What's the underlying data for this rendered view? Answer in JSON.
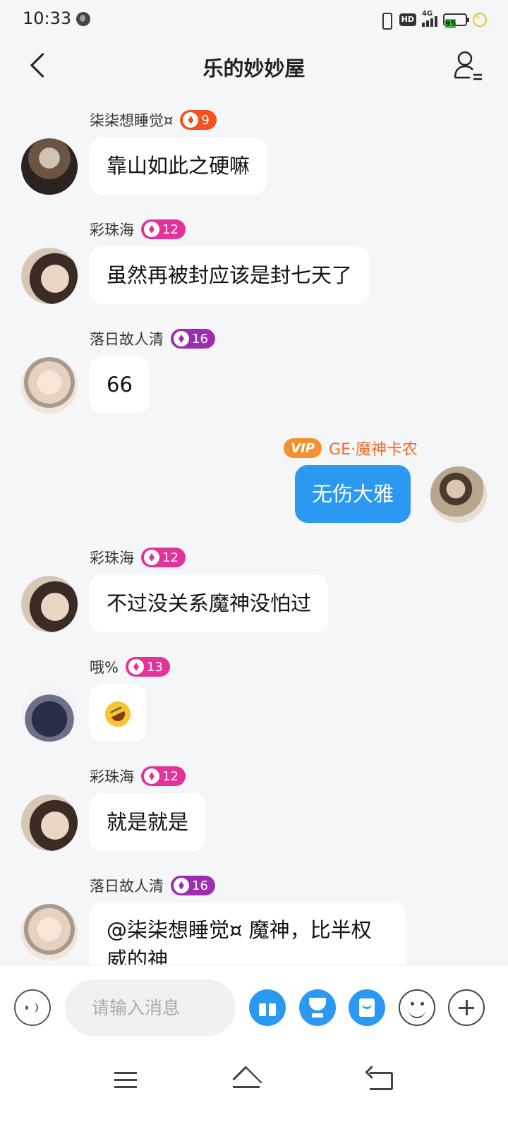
{
  "status_bar": {
    "time": "10:33",
    "network": "4G",
    "hd_label": "HD",
    "battery": "95"
  },
  "header": {
    "title": "乐的妙妙屋"
  },
  "messages": [
    {
      "sender": "柒柒想睡觉¤",
      "level": "9",
      "badge_color": "#f4511e",
      "text": "靠山如此之硬嘛"
    },
    {
      "sender": "彩珠海",
      "level": "12",
      "badge_color": "#e3329a",
      "text": "虽然再被封应该是封七天了"
    },
    {
      "sender": "落日故人清",
      "level": "16",
      "badge_color": "#9b2fb0",
      "text": "66"
    },
    {
      "sender": "GE·魔神卡农",
      "vip": "VIP",
      "text": "无伤大雅"
    },
    {
      "sender": "彩珠海",
      "level": "12",
      "badge_color": "#e3329a",
      "text": "不过没关系魔神没怕过"
    },
    {
      "sender": "哦%",
      "level": "13",
      "badge_color": "#e3329a",
      "text": "rolling-on-floor-laughing-emoji"
    },
    {
      "sender": "彩珠海",
      "level": "12",
      "badge_color": "#e3329a",
      "text": "就是就是"
    },
    {
      "sender": "落日故人清",
      "level": "16",
      "badge_color": "#9b2fb0",
      "text": "@柒柒想睡觉¤ 魔神，比半权威的神"
    }
  ],
  "input_bar": {
    "placeholder": "请输入消息",
    "icons": [
      "voice-icon",
      "gift-icon",
      "trophy-icon",
      "red-packet-icon",
      "emoji-icon",
      "plus-icon"
    ]
  },
  "colors": {
    "accent": "#2b98f2",
    "vip": "#f3912e",
    "self_name": "#f06a2c"
  }
}
